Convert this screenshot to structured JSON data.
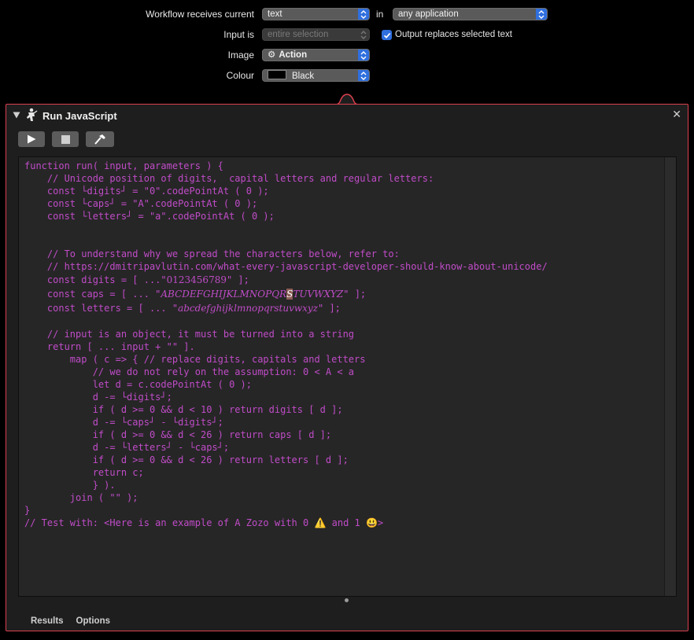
{
  "header": {
    "receives_label": "Workflow receives current",
    "receives_value": "text",
    "in_label": "in",
    "app_value": "any application",
    "input_is_label": "Input is",
    "input_is_value": "entire selection",
    "output_replaces_label": "Output replaces selected text",
    "output_replaces_checked": true,
    "image_label": "Image",
    "image_value": "Action",
    "colour_label": "Colour",
    "colour_value": "Black"
  },
  "action": {
    "title": "Run JavaScript",
    "toolbar": {
      "run_icon": "play-icon",
      "stop_icon": "stop-icon",
      "compile_icon": "hammer-icon"
    },
    "code_lines": [
      "function run( input, parameters ) {",
      "    // Unicode position of digits,  capital letters and regular letters:",
      "    const └digits┘ = \"0\".codePointAt ( 0 );",
      "    const └caps┘ = \"A\".codePointAt ( 0 );",
      "    const └letters┘ = \"a\".codePointAt ( 0 );",
      "",
      "",
      "    // To understand why we spread the characters below, refer to:",
      "    // https://dmitripavlutin.com/what-every-javascript-developer-should-know-about-unicode/"
    ],
    "digits_line": {
      "prefix": "    const digits = [ ...\"",
      "styled": "0123456789",
      "suffix": "\" ];"
    },
    "caps_line": {
      "prefix": "    const caps = [ ... \"",
      "styled_a": "ABCDEFGHIJKLMNOPQR",
      "cursor": "S",
      "styled_b": "TUVWXYZ",
      "suffix": "\" ];"
    },
    "letters_line": {
      "prefix": "    const letters = [ ... \"",
      "styled": "abcdefghijklmnopqrstuvwxyz",
      "suffix": "\" ];"
    },
    "code_lines_2": [
      "",
      "    // input is an object, it must be turned into a string",
      "    return [ ... input + \"\" ].",
      "        map ( c => { // replace digits, capitals and letters",
      "            // we do not rely on the assumption: 0 < A < a",
      "            let d = c.codePointAt ( 0 );",
      "            d -= └digits┘;",
      "            if ( d >= 0 && d < 10 ) return digits [ d ];",
      "            d -= └caps┘ - └digits┘;",
      "            if ( d >= 0 && d < 26 ) return caps [ d ];",
      "            d -= └letters┘ - └caps┘;",
      "            if ( d >= 0 && d < 26 ) return letters [ d ];",
      "            return c;",
      "            } ).",
      "        join ( \"\" );",
      "}",
      "// Test with: <Here is an example of A Zozo with 0 ⚠️ and 1 😃>"
    ]
  },
  "bottom_tabs": [
    "Results",
    "Options"
  ]
}
